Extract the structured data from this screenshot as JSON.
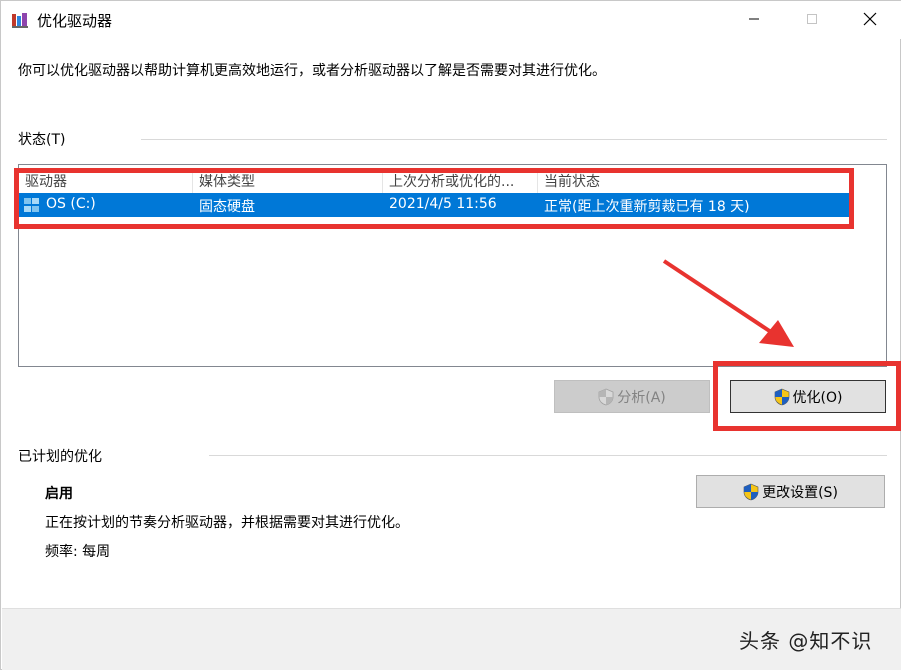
{
  "window": {
    "title": "优化驱动器"
  },
  "description": "你可以优化驱动器以帮助计算机更高效地运行，或者分析驱动器以了解是否需要对其进行优化。",
  "status_group": {
    "label": "状态(T)"
  },
  "drive_list": {
    "columns": [
      "驱动器",
      "媒体类型",
      "上次分析或优化的...",
      "当前状态"
    ],
    "rows": [
      {
        "drive": "OS (C:)",
        "media_type": "固态硬盘",
        "last_run": "2021/4/5 11:56",
        "status": "正常(距上次重新剪裁已有 18 天)",
        "selected": true
      }
    ]
  },
  "buttons": {
    "analyze": "分析(A)",
    "optimize": "优化(O)",
    "change_settings": "更改设置(S)"
  },
  "scheduled_group": {
    "label": "已计划的优化",
    "state": "启用",
    "description": "正在按计划的节奏分析驱动器，并根据需要对其进行优化。",
    "frequency": "频率: 每周"
  },
  "watermark": "头条 @知不识",
  "colors": {
    "selection": "#0078d7",
    "highlight": "#e8332f",
    "footer": "#f0f0f0"
  }
}
